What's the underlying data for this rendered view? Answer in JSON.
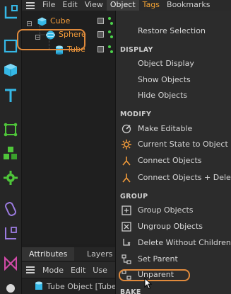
{
  "menubar": {
    "items": [
      {
        "label": "File"
      },
      {
        "label": "Edit"
      },
      {
        "label": "View"
      },
      {
        "label": "Object"
      },
      {
        "label": "Tags"
      },
      {
        "label": "Bookmarks"
      }
    ],
    "active": "Object"
  },
  "objects": [
    {
      "name": "Cube",
      "icon": "cube-icon",
      "color": "#f29b3a"
    },
    {
      "name": "Sphere",
      "icon": "sphere-icon",
      "color": "#f29b3a"
    },
    {
      "name": "Tube",
      "icon": "tube-icon",
      "color": "#f29b3a"
    }
  ],
  "dropdown": {
    "restore_selection": "Restore Selection",
    "sections": {
      "display": "DISPLAY",
      "modify": "MODIFY",
      "group": "GROUP",
      "bake": "BAKE"
    },
    "display_items": [
      "Object Display",
      "Show Objects",
      "Hide Objects"
    ],
    "modify_items": [
      "Make Editable",
      "Current State to Object",
      "Connect Objects",
      "Connect Objects + Delete"
    ],
    "group_items": [
      "Group Objects",
      "Ungroup Objects",
      "Delete Without Children",
      "Set Parent",
      "Unparent"
    ]
  },
  "attributes": {
    "tabs": [
      "Attributes",
      "Layers"
    ],
    "menu": [
      "Mode",
      "Edit",
      "Use"
    ],
    "object_label": "Tube Object [Tube]"
  },
  "colors": {
    "accent": "#f29b3a",
    "highlight_ring": "#e08a3c",
    "tool_cyan": "#35b8e6",
    "tool_green": "#4fc63a",
    "tool_purple": "#9b7be0"
  }
}
